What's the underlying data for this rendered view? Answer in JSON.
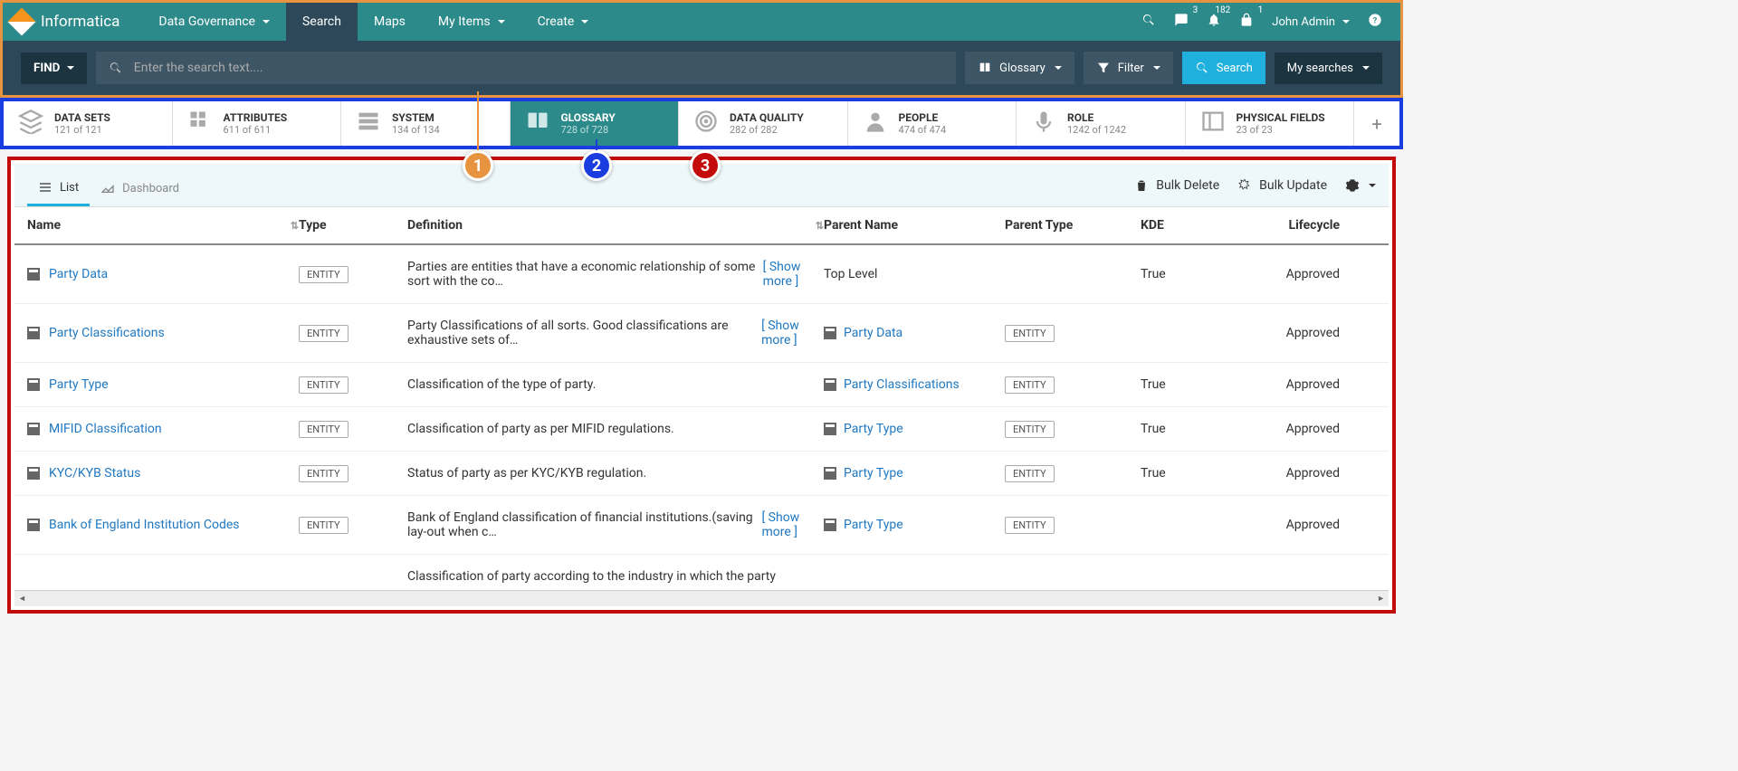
{
  "brand": "Informatica",
  "nav": {
    "items": [
      {
        "label": "Data Governance",
        "caret": true
      },
      {
        "label": "Search",
        "active": true
      },
      {
        "label": "Maps"
      },
      {
        "label": "My Items",
        "caret": true
      },
      {
        "label": "Create",
        "caret": true
      }
    ]
  },
  "topright": {
    "chat_badge": "3",
    "bell_badge": "182",
    "lock_badge": "1",
    "user": "John Admin"
  },
  "searchbar": {
    "find": "FIND",
    "placeholder": "Enter the search text....",
    "glossary": "Glossary",
    "filter": "Filter",
    "search": "Search",
    "mysearches": "My searches"
  },
  "asset_tabs": [
    {
      "label": "DATA SETS",
      "count": "121 of 121",
      "icon": "layers"
    },
    {
      "label": "ATTRIBUTES",
      "count": "611 of 611",
      "icon": "grid"
    },
    {
      "label": "SYSTEM",
      "count": "134 of 134",
      "icon": "server"
    },
    {
      "label": "GLOSSARY",
      "count": "728 of 728",
      "icon": "book",
      "active": true
    },
    {
      "label": "DATA QUALITY",
      "count": "282 of 282",
      "icon": "target"
    },
    {
      "label": "PEOPLE",
      "count": "474 of 474",
      "icon": "person"
    },
    {
      "label": "ROLE",
      "count": "1242 of 1242",
      "icon": "mic"
    },
    {
      "label": "PHYSICAL FIELDS",
      "count": "23 of 23",
      "icon": "layout"
    }
  ],
  "view": {
    "list": "List",
    "dashboard": "Dashboard",
    "bulk_delete": "Bulk Delete",
    "bulk_update": "Bulk Update"
  },
  "columns": {
    "name": "Name",
    "type": "Type",
    "def": "Definition",
    "parent": "Parent Name",
    "ptype": "Parent Type",
    "kde": "KDE",
    "life": "Lifecycle"
  },
  "show_more": "[ Show more ]",
  "entity_label": "ENTITY",
  "rows": [
    {
      "name": "Party Data",
      "type": "ENTITY",
      "def": "Parties are entities that have a economic relationship of some sort with the co…",
      "more": true,
      "parent": "Top Level",
      "parent_link": false,
      "ptype": "",
      "kde": "True",
      "life": "Approved"
    },
    {
      "name": "Party Classifications",
      "type": "ENTITY",
      "def": "Party Classifications of all sorts. Good classifications are exhaustive sets of…",
      "more": true,
      "parent": "Party Data",
      "parent_link": true,
      "ptype": "ENTITY",
      "kde": "",
      "life": "Approved"
    },
    {
      "name": "Party Type",
      "type": "ENTITY",
      "def": "Classification of the type of party.",
      "more": false,
      "parent": "Party Classifications",
      "parent_link": true,
      "ptype": "ENTITY",
      "kde": "True",
      "life": "Approved"
    },
    {
      "name": "MIFID Classification",
      "type": "ENTITY",
      "def": "Classification of party as per MIFID regulations.",
      "more": false,
      "parent": "Party Type",
      "parent_link": true,
      "ptype": "ENTITY",
      "kde": "True",
      "life": "Approved"
    },
    {
      "name": "KYC/KYB Status",
      "type": "ENTITY",
      "def": "Status of party as per KYC/KYB regulation.",
      "more": false,
      "parent": "Party Type",
      "parent_link": true,
      "ptype": "ENTITY",
      "kde": "True",
      "life": "Approved"
    },
    {
      "name": "Bank of England Institution Codes",
      "type": "ENTITY",
      "def": "Bank of England classification of financial institutions.(saving lay-out when c…",
      "more": true,
      "parent": "Party Type",
      "parent_link": true,
      "ptype": "ENTITY",
      "kde": "",
      "life": "Approved"
    },
    {
      "name": "",
      "type": "",
      "def": "Classification of party according to the industry in which the party",
      "more": false,
      "parent": "",
      "parent_link": false,
      "ptype": "",
      "kde": "",
      "life": ""
    }
  ],
  "callouts": {
    "c1": "1",
    "c2": "2",
    "c3": "3"
  }
}
